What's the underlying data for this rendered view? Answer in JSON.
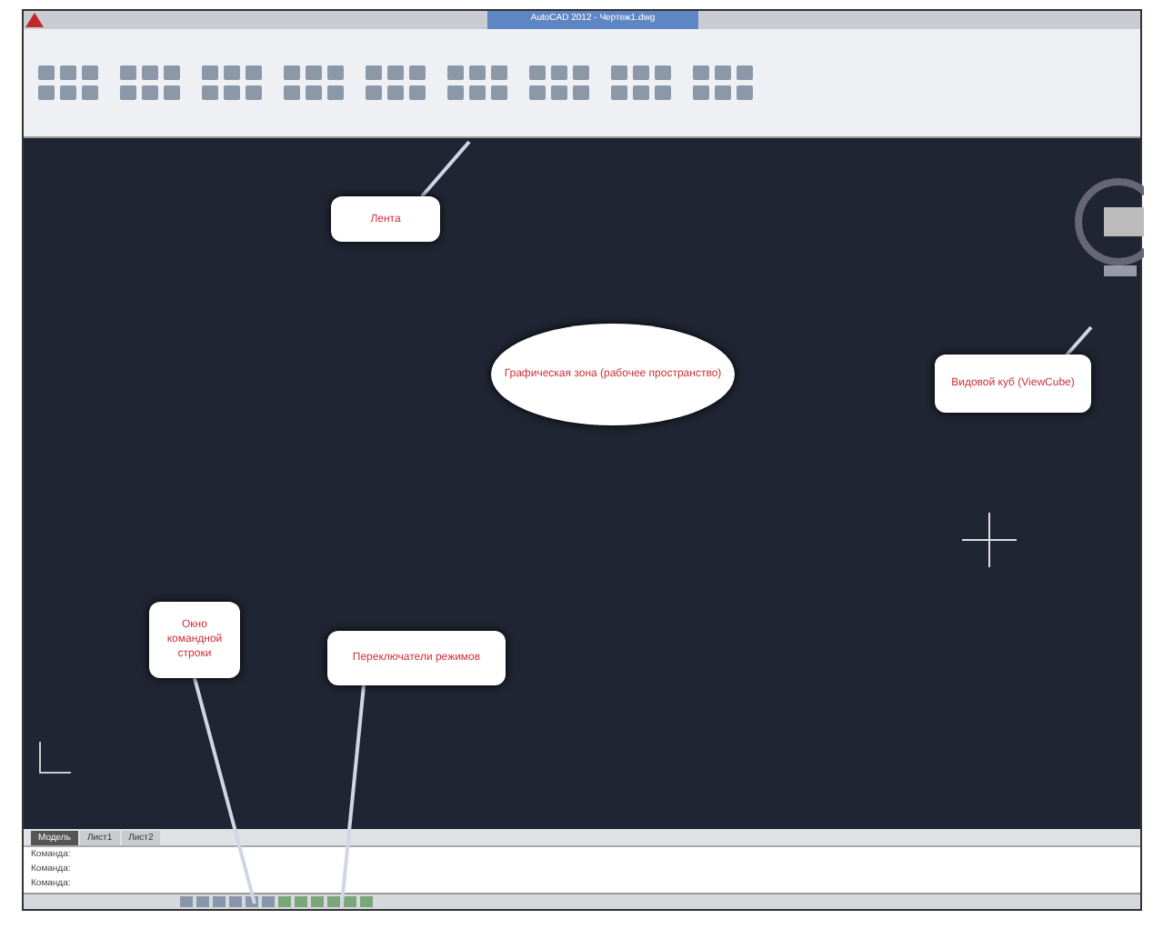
{
  "window": {
    "title": "AutoCAD 2012 - Чертеж1.dwg"
  },
  "layout_tabs": [
    {
      "label": "Модель",
      "selected": true
    },
    {
      "label": "Лист1",
      "selected": false
    },
    {
      "label": "Лист2",
      "selected": false
    }
  ],
  "command_line": {
    "lines": [
      "Команда:",
      "Команда:"
    ],
    "prompt": "Команда:"
  },
  "callouts": [
    {
      "kind": "box",
      "text": "Лента"
    },
    {
      "kind": "ellipse",
      "text": "Графическая зона (рабочее пространство)"
    },
    {
      "kind": "box",
      "text": "Видовой куб (ViewCube)"
    },
    {
      "kind": "box",
      "text": "Окно командной строки"
    },
    {
      "kind": "box",
      "text": "Переключатели режимов"
    }
  ]
}
